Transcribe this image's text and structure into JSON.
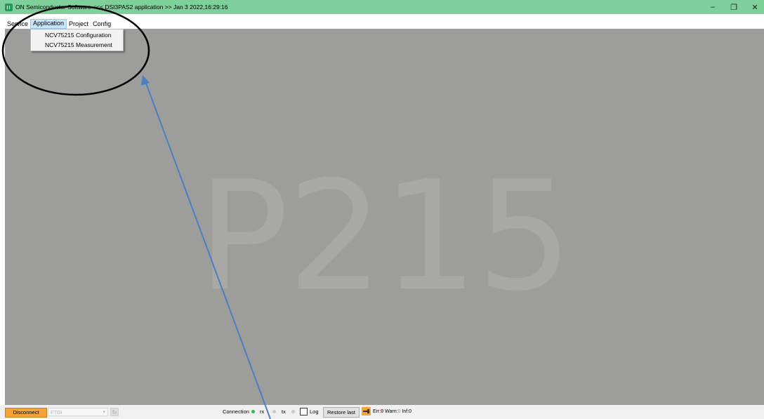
{
  "window": {
    "title": "ON Semiconductor Software <<< DSI3PAS2 application >> Jan  3 2022,16:29:16",
    "minimize_icon": "minimize-icon",
    "restore_icon": "restore-icon",
    "close_icon": "close-icon"
  },
  "menubar": {
    "items": [
      {
        "label": "Service"
      },
      {
        "label": "Application",
        "active": true
      },
      {
        "label": "Project"
      },
      {
        "label": "Config"
      }
    ]
  },
  "dropdown": {
    "items": [
      {
        "label": "NCV75215 Configuration"
      },
      {
        "label": "NCV75215 Measurement"
      }
    ]
  },
  "workspace": {
    "watermark": "P215"
  },
  "statusbar": {
    "disconnect_label": "Disconnect",
    "device_select_value": "FTDI",
    "connection_label": "Connection",
    "rx_label": "rx",
    "tx_label": "tx",
    "log_label": "Log",
    "log_checked": false,
    "restore_label": "Restore last",
    "err_label": "Err:",
    "err_value": "0",
    "warn_label": "Warn:",
    "warn_value": "0",
    "inf_label": "Inf:",
    "inf_value": "0"
  },
  "colors": {
    "titlebar": "#7ecf9a",
    "workspace": "#9d9d9c",
    "disconnect_button": "#f2a43a",
    "annotation_ellipse": "#000000",
    "annotation_arrow": "#4a7fc1",
    "led_connection": "#3bb54a",
    "led_inactive": "#c8c8c8"
  }
}
